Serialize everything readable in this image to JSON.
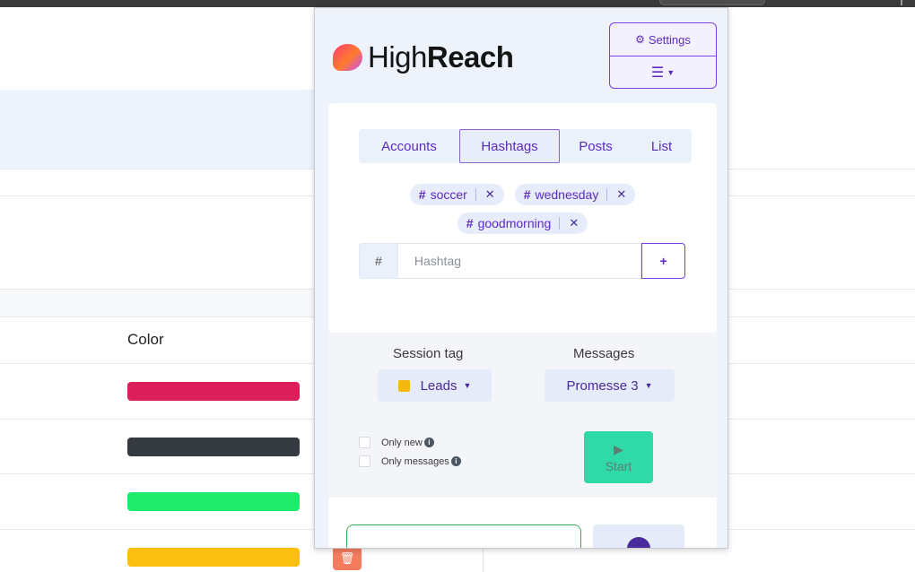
{
  "popup": {
    "brand": {
      "light": "High",
      "bold": "Reach"
    },
    "settings_label": "Settings",
    "menu_icon": "hamburger-icon",
    "tabs": [
      {
        "label": "Accounts",
        "active": false
      },
      {
        "label": "Hashtags",
        "active": true
      },
      {
        "label": "Posts",
        "active": false
      },
      {
        "label": "List",
        "active": false
      }
    ],
    "hashtag_chips": [
      {
        "hash": "#",
        "label": "soccer",
        "remove": "✕"
      },
      {
        "hash": "#",
        "label": "wednesday",
        "remove": "✕"
      },
      {
        "hash": "#",
        "label": "goodmorning",
        "remove": "✕"
      }
    ],
    "hashtag_input": {
      "prefix": "#",
      "placeholder": "Hashtag",
      "value": "",
      "add_label": "+"
    },
    "session_tag": {
      "label": "Session tag",
      "value": "Leads",
      "color": "#f6b80f"
    },
    "messages": {
      "label": "Messages",
      "value": "Promesse 3"
    },
    "options": [
      {
        "label": "Only new",
        "checked": false
      },
      {
        "label": "Only messages",
        "checked": false
      }
    ],
    "start_label": "Start",
    "colors": {
      "accent": "#5b2bbf",
      "start": "#2fd9a8"
    }
  },
  "background": {
    "column_header": "Color",
    "swatches": [
      "#dc1f5a",
      "#343a40",
      "#1eea6b",
      "#fbbf10"
    ]
  }
}
